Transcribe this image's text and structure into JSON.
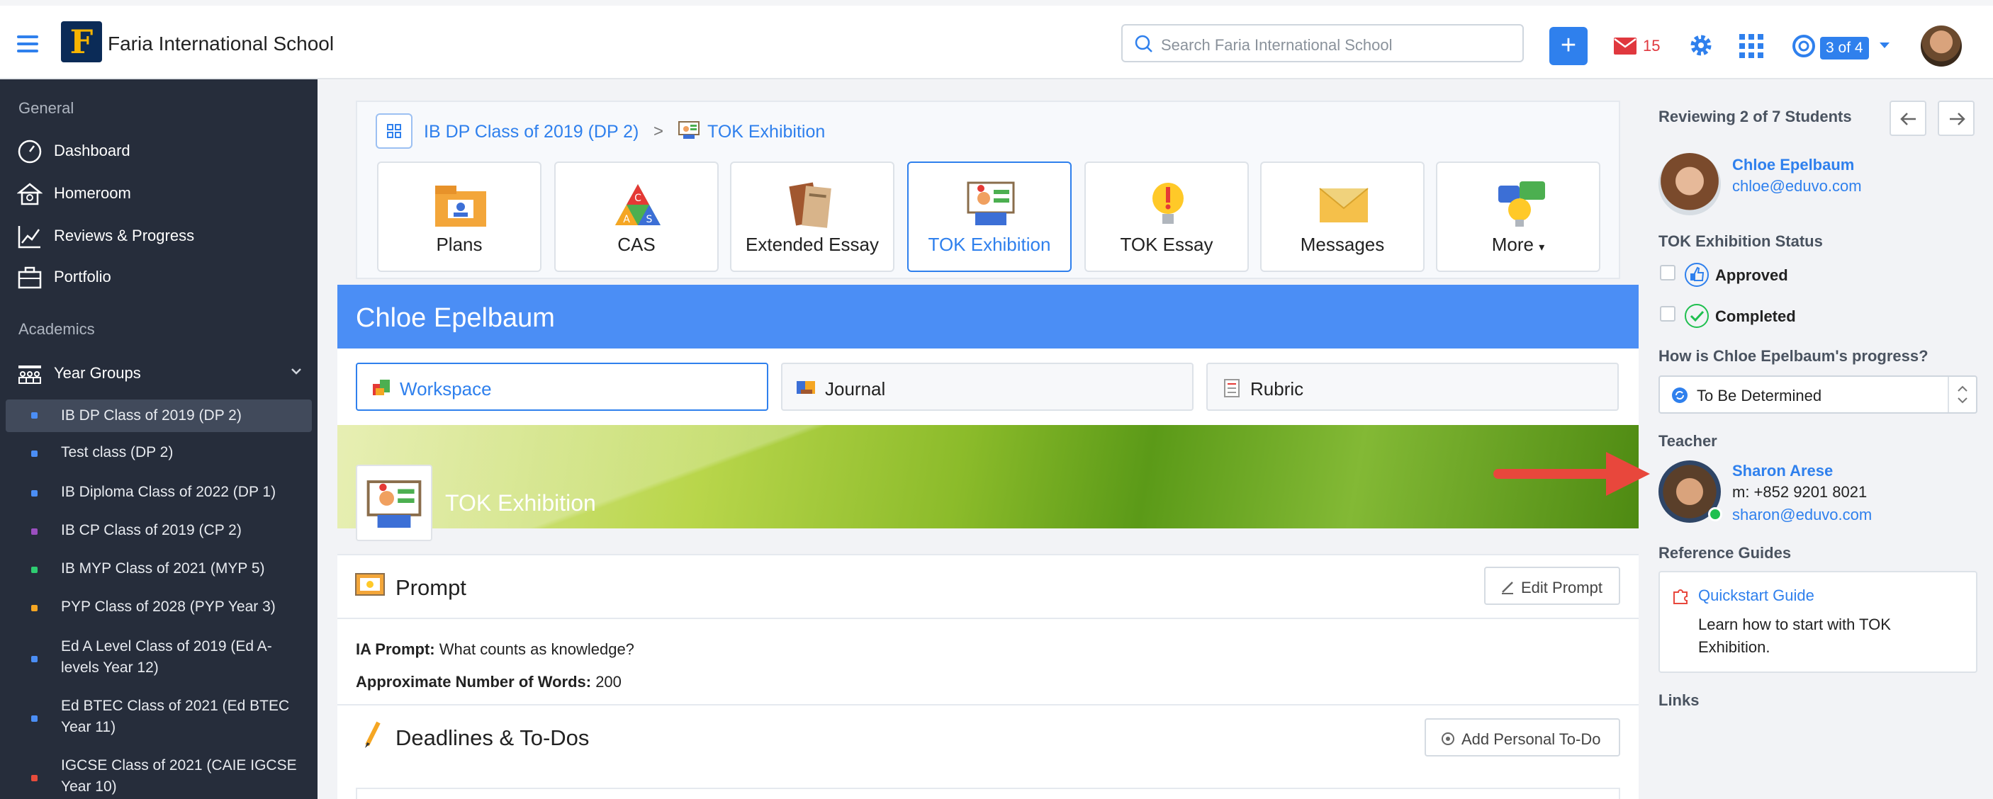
{
  "topbar": {
    "school_name": "Faria International School",
    "logo_letter": "F",
    "search_placeholder": "Search Faria International School",
    "mail_count": "15",
    "pager": "3 of 4"
  },
  "sidebar": {
    "general_heading": "General",
    "general_items": [
      {
        "label": "Dashboard",
        "icon": "dashboard-icon"
      },
      {
        "label": "Homeroom",
        "icon": "homeroom-icon"
      },
      {
        "label": "Reviews & Progress",
        "icon": "chart-line-icon"
      },
      {
        "label": "Portfolio",
        "icon": "briefcase-icon"
      }
    ],
    "academics_heading": "Academics",
    "year_groups_label": "Year Groups",
    "classes": [
      {
        "label": "IB DP Class of 2019 (DP 2)",
        "color": "#4b8ef5",
        "active": true
      },
      {
        "label": "Test class (DP 2)",
        "color": "#4b8ef5"
      },
      {
        "label": "IB Diploma Class of 2022 (DP 1)",
        "color": "#4b8ef5"
      },
      {
        "label": "IB CP Class of 2019 (CP 2)",
        "color": "#9b4fc0"
      },
      {
        "label": "IB MYP Class of 2021 (MYP 5)",
        "color": "#2ecc71"
      },
      {
        "label": "PYP Class of 2028 (PYP Year 3)",
        "color": "#f5a623"
      },
      {
        "label": "Ed A Level Class of 2019 (Ed A-levels Year 12)",
        "color": "#4b8ef5"
      },
      {
        "label": "Ed BTEC Class of 2021 (Ed BTEC Year 11)",
        "color": "#4b8ef5"
      },
      {
        "label": "IGCSE Class of 2021 (CAIE IGCSE Year 10)",
        "color": "#e74c3c"
      }
    ]
  },
  "breadcrumb": {
    "class": "IB DP Class of 2019 (DP 2)",
    "separator": ">",
    "page": "TOK Exhibition"
  },
  "tiles": [
    {
      "label": "Plans",
      "icon": "plans-folder-icon"
    },
    {
      "label": "CAS",
      "icon": "cas-triangle-icon"
    },
    {
      "label": "Extended Essay",
      "icon": "books-icon"
    },
    {
      "label": "TOK Exhibition",
      "icon": "presentation-icon",
      "active": true
    },
    {
      "label": "TOK Essay",
      "icon": "lightbulb-icon"
    },
    {
      "label": "Messages",
      "icon": "envelope-icon"
    },
    {
      "label": "More",
      "icon": "ideas-icon"
    }
  ],
  "student": {
    "name": "Chloe Epelbaum"
  },
  "subtabs": [
    {
      "label": "Workspace",
      "icon": "workspace-icon",
      "active": true
    },
    {
      "label": "Journal",
      "icon": "journal-icon"
    },
    {
      "label": "Rubric",
      "icon": "rubric-icon"
    }
  ],
  "banner": {
    "title": "TOK Exhibition"
  },
  "prompt": {
    "title": "Prompt",
    "edit_label": "Edit Prompt",
    "ia_label": "IA Prompt:",
    "ia_value": "What counts as knowledge?",
    "words_label": "Approximate Number of Words:",
    "words_value": "200"
  },
  "deadlines": {
    "title": "Deadlines & To-Dos",
    "add_label": "Add Personal To-Do"
  },
  "right_panel": {
    "reviewing": "Reviewing 2 of 7 Students",
    "student_name": "Chloe Epelbaum",
    "student_email": "chloe@eduvo.com",
    "status_heading": "TOK Exhibition Status",
    "approved": "Approved",
    "completed": "Completed",
    "progress_question": "How is Chloe Epelbaum's progress?",
    "progress_value": "To Be Determined",
    "teacher_heading": "Teacher",
    "teacher_name": "Sharon Arese",
    "teacher_phone": "m: +852 9201 8021",
    "teacher_email": "sharon@eduvo.com",
    "guides_heading": "Reference Guides",
    "guide_title": "Quickstart Guide",
    "guide_desc": "Learn how to start with TOK Exhibition.",
    "links_heading": "Links"
  },
  "colors": {
    "accent": "#2f80ed",
    "sidebar": "#262d3b",
    "student_bar": "#4b8ef5",
    "arrow": "#e8473c"
  }
}
